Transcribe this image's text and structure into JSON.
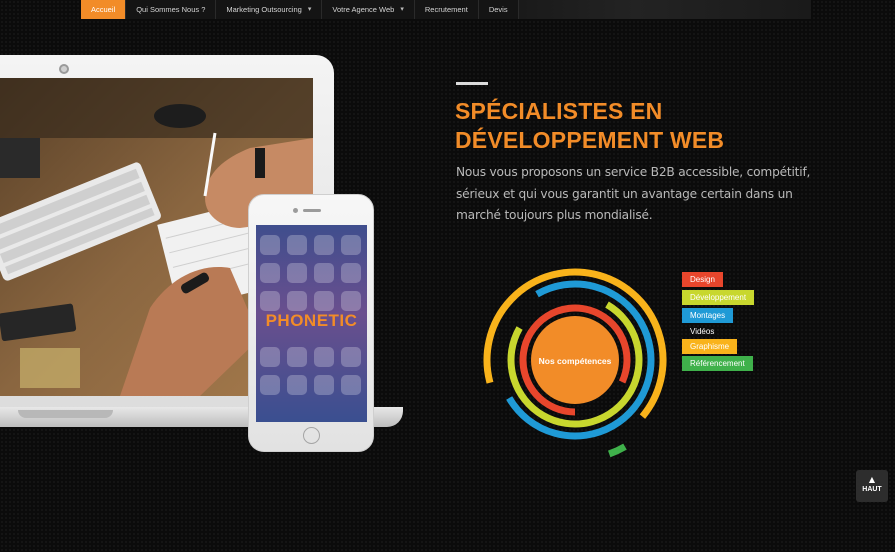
{
  "nav": {
    "items": [
      {
        "label": "Accueil",
        "active": true,
        "dropdown": false
      },
      {
        "label": "Qui Sommes Nous ?",
        "active": false,
        "dropdown": false
      },
      {
        "label": "Marketing Outsourcing",
        "active": false,
        "dropdown": true
      },
      {
        "label": "Votre Agence Web",
        "active": false,
        "dropdown": true
      },
      {
        "label": "Recrutement",
        "active": false,
        "dropdown": false
      },
      {
        "label": "Devis",
        "active": false,
        "dropdown": false
      }
    ],
    "dropdown_icon": "chevron-down-icon"
  },
  "phone": {
    "logo_text": "PHONETIC"
  },
  "hero": {
    "title_line1": "SPÉCIALISTES EN",
    "title_line2": "DÉVELOPPEMENT WEB",
    "intro": "Nous vous proposons un service B2B accessible, compétitif, sérieux et qui vous garantit un avantage certain dans un marché toujours plus mondialisé."
  },
  "competences": {
    "center_label": "Nos compétences",
    "legend": [
      {
        "label": "Design",
        "color": "#e8462c"
      },
      {
        "label": "Développement",
        "color": "#c8d72e"
      },
      {
        "label": "Montages",
        "color": "#1f9ad6"
      },
      {
        "label": "Vidéos",
        "color": "transparent"
      },
      {
        "label": "Graphisme",
        "color": "#f9b31b"
      },
      {
        "label": "Référencement",
        "color": "#3fb14b"
      }
    ],
    "rings": [
      {
        "color": "#3fb14b"
      },
      {
        "color": "#f9b31b"
      },
      {
        "color": "#1f9ad6"
      },
      {
        "color": "#c8d72e"
      },
      {
        "color": "#e8462c"
      }
    ],
    "center_color": "#f28c28"
  },
  "back_to_top": {
    "label": "HAUT",
    "icon": "arrow-up-icon"
  },
  "colors": {
    "accent": "#f28c28",
    "background": "#0b0b0b"
  }
}
